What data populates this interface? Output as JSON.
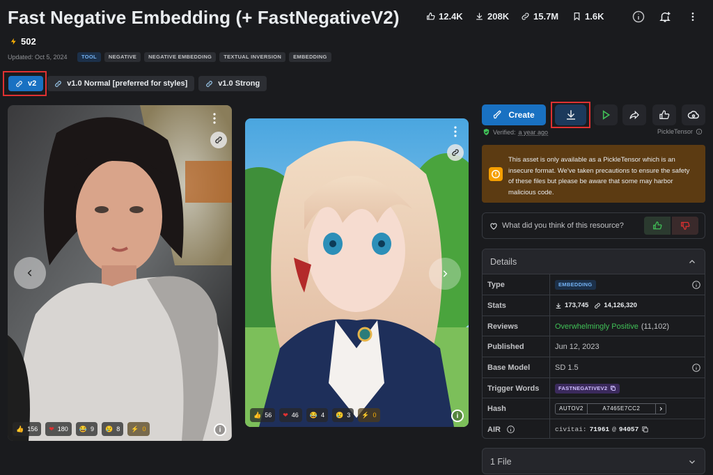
{
  "title": "Fast Negative Embedding (+ FastNegativeV2)",
  "header_stats": [
    {
      "icon": "thumbs-up-icon",
      "value": "12.4K"
    },
    {
      "icon": "download-icon",
      "value": "208K"
    },
    {
      "icon": "link-icon",
      "value": "15.7M"
    },
    {
      "icon": "bookmark-icon",
      "value": "1.6K"
    }
  ],
  "buzz": "502",
  "updated": "Updated: Oct 5, 2024",
  "tags": [
    "TOOL",
    "NEGATIVE",
    "NEGATIVE EMBEDDING",
    "TEXTUAL INVERSION",
    "EMBEDDING"
  ],
  "versions": [
    "v2",
    "v1.0 Normal [preferred for styles]",
    "v1.0 Strong"
  ],
  "gallery": [
    {
      "reactions": {
        "like": "156",
        "heart": "180",
        "laugh": "9",
        "cry": "8",
        "buzz": "0"
      }
    },
    {
      "reactions": {
        "like": "56",
        "heart": "46",
        "laugh": "4",
        "cry": "3",
        "buzz": "0"
      }
    }
  ],
  "actions": {
    "create": "Create"
  },
  "verified": {
    "label": "Verified:",
    "when": "a year ago",
    "format": "PickleTensor"
  },
  "warning": "This asset is only available as a PickleTensor which is an insecure format. We've taken precautions to ensure the safety of these files but please be aware that some may harbor malicious code.",
  "feedback": {
    "question": "What did you think of this resource?"
  },
  "details": {
    "header": "Details",
    "type_label": "Type",
    "type_value": "EMBEDDING",
    "stats_label": "Stats",
    "stats_downloads": "173,745",
    "stats_generations": "14,126,320",
    "reviews_label": "Reviews",
    "reviews_value": "Overwhelmingly Positive",
    "reviews_count": "(11,102)",
    "published_label": "Published",
    "published_value": "Jun 12, 2023",
    "base_label": "Base Model",
    "base_value": "SD 1.5",
    "trigger_label": "Trigger Words",
    "trigger_value": "FASTNEGATIVEV2",
    "hash_label": "Hash",
    "hash_type": "AUTOV2",
    "hash_value": "A7465E7CC2",
    "air_label": "AIR",
    "air_prefix": "civitai:",
    "air_model": "71961",
    "air_at": "@",
    "air_version": "94057"
  },
  "files": {
    "header": "1 File"
  },
  "colors": {
    "accent": "#1971c2",
    "green": "#40c057",
    "warning_bg": "#5c3b12",
    "warning_icon": "#f59f00",
    "danger": "#e03131"
  }
}
